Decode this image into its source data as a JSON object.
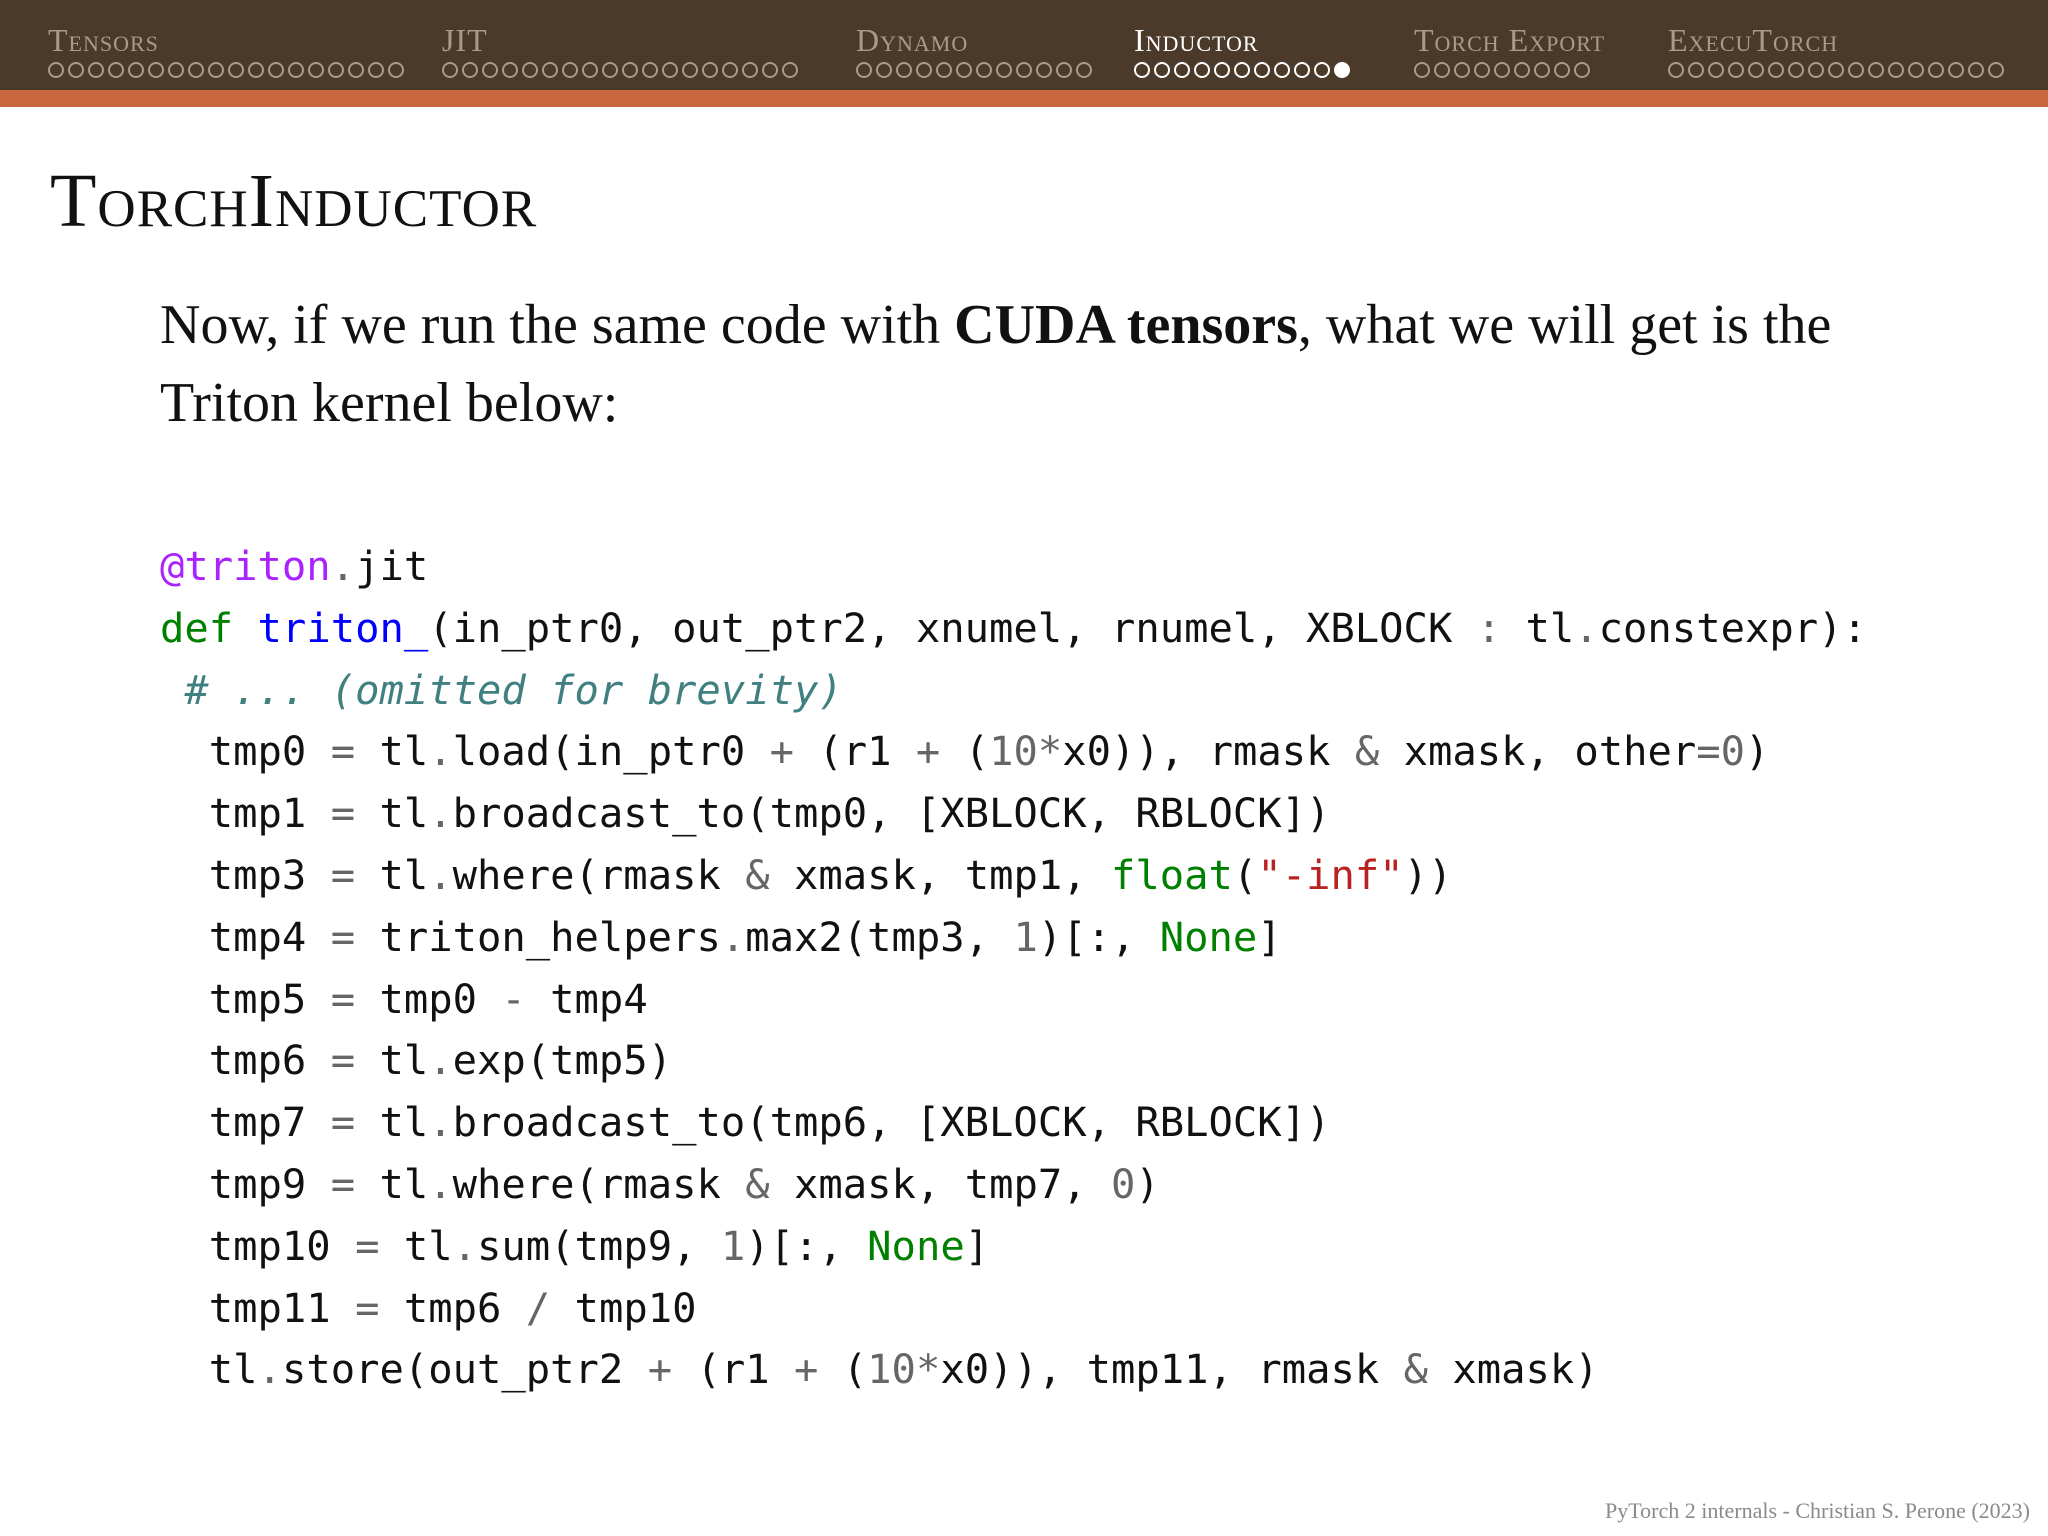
{
  "nav": {
    "sections": [
      {
        "label": "Tensors",
        "dots": 18,
        "current": false
      },
      {
        "label": "JIT",
        "dots": 18,
        "current": false
      },
      {
        "label": "Dynamo",
        "dots": 12,
        "current": false
      },
      {
        "label": "Inductor",
        "dots": 11,
        "current": true,
        "active_dot": 11
      },
      {
        "label": "Torch Export",
        "dots": 9,
        "current": false
      },
      {
        "label": "ExecuTorch",
        "dots": 17,
        "current": false
      }
    ]
  },
  "slide": {
    "title": "TorchInductor",
    "intro": {
      "before": "Now, if we run the same code with ",
      "bold": "CUDA tensors",
      "after": ", what we will get is the Triton kernel below:"
    },
    "code": [
      [
        [
          "nd",
          "@triton"
        ],
        [
          "op",
          "."
        ],
        [
          "",
          "jit"
        ]
      ],
      [
        [
          "kw",
          "def"
        ],
        [
          "",
          " "
        ],
        [
          "nf",
          "triton_"
        ],
        [
          "",
          "(in_ptr0, out_ptr2, xnumel, rnumel, XBLOCK "
        ],
        [
          "op",
          ":"
        ],
        [
          "",
          " tl"
        ],
        [
          "op",
          "."
        ],
        [
          "",
          "constexpr):"
        ]
      ],
      [
        [
          "",
          " "
        ],
        [
          "c1",
          "# ... (omitted for brevity)"
        ]
      ],
      [
        [
          "",
          "  tmp0 "
        ],
        [
          "op",
          "="
        ],
        [
          "",
          " tl"
        ],
        [
          "op",
          "."
        ],
        [
          "",
          "load(in_ptr0 "
        ],
        [
          "op",
          "+"
        ],
        [
          "",
          " (r1 "
        ],
        [
          "op",
          "+"
        ],
        [
          "",
          " ("
        ],
        [
          "mi",
          "10"
        ],
        [
          "op",
          "*"
        ],
        [
          "",
          "x0)), rmask "
        ],
        [
          "op",
          "&"
        ],
        [
          "",
          " xmask, other"
        ],
        [
          "op",
          "="
        ],
        [
          "mi",
          "0"
        ],
        [
          "",
          ")"
        ]
      ],
      [
        [
          "",
          "  tmp1 "
        ],
        [
          "op",
          "="
        ],
        [
          "",
          " tl"
        ],
        [
          "op",
          "."
        ],
        [
          "",
          "broadcast_to(tmp0, [XBLOCK, RBLOCK])"
        ]
      ],
      [
        [
          "",
          "  tmp3 "
        ],
        [
          "op",
          "="
        ],
        [
          "",
          " tl"
        ],
        [
          "op",
          "."
        ],
        [
          "",
          "where(rmask "
        ],
        [
          "op",
          "&"
        ],
        [
          "",
          " xmask, tmp1, "
        ],
        [
          "bi",
          "float"
        ],
        [
          "",
          "("
        ],
        [
          "st",
          "\"-inf\""
        ],
        [
          "",
          "))"
        ]
      ],
      [
        [
          "",
          "  tmp4 "
        ],
        [
          "op",
          "="
        ],
        [
          "",
          " triton_helpers"
        ],
        [
          "op",
          "."
        ],
        [
          "",
          "max2(tmp3, "
        ],
        [
          "mi",
          "1"
        ],
        [
          "",
          ")[:, "
        ],
        [
          "bi",
          "None"
        ],
        [
          "",
          "]"
        ]
      ],
      [
        [
          "",
          "  tmp5 "
        ],
        [
          "op",
          "="
        ],
        [
          "",
          " tmp0 "
        ],
        [
          "op",
          "-"
        ],
        [
          "",
          " tmp4"
        ]
      ],
      [
        [
          "",
          "  tmp6 "
        ],
        [
          "op",
          "="
        ],
        [
          "",
          " tl"
        ],
        [
          "op",
          "."
        ],
        [
          "",
          "exp(tmp5)"
        ]
      ],
      [
        [
          "",
          "  tmp7 "
        ],
        [
          "op",
          "="
        ],
        [
          "",
          " tl"
        ],
        [
          "op",
          "."
        ],
        [
          "",
          "broadcast_to(tmp6, [XBLOCK, RBLOCK])"
        ]
      ],
      [
        [
          "",
          "  tmp9 "
        ],
        [
          "op",
          "="
        ],
        [
          "",
          " tl"
        ],
        [
          "op",
          "."
        ],
        [
          "",
          "where(rmask "
        ],
        [
          "op",
          "&"
        ],
        [
          "",
          " xmask, tmp7, "
        ],
        [
          "mi",
          "0"
        ],
        [
          "",
          ")"
        ]
      ],
      [
        [
          "",
          "  tmp10 "
        ],
        [
          "op",
          "="
        ],
        [
          "",
          " tl"
        ],
        [
          "op",
          "."
        ],
        [
          "",
          "sum(tmp9, "
        ],
        [
          "mi",
          "1"
        ],
        [
          "",
          ")[:, "
        ],
        [
          "bi",
          "None"
        ],
        [
          "",
          "]"
        ]
      ],
      [
        [
          "",
          "  tmp11 "
        ],
        [
          "op",
          "="
        ],
        [
          "",
          " tmp6 "
        ],
        [
          "op",
          "/"
        ],
        [
          "",
          " tmp10"
        ]
      ],
      [
        [
          "",
          "  tl"
        ],
        [
          "op",
          "."
        ],
        [
          "",
          "store(out_ptr2 "
        ],
        [
          "op",
          "+"
        ],
        [
          "",
          " (r1 "
        ],
        [
          "op",
          "+"
        ],
        [
          "",
          " ("
        ],
        [
          "mi",
          "10"
        ],
        [
          "op",
          "*"
        ],
        [
          "",
          "x0)), tmp11, rmask "
        ],
        [
          "op",
          "&"
        ],
        [
          "",
          " xmask)"
        ]
      ]
    ]
  },
  "footer": "PyTorch 2 internals - Christian S. Perone (2023)",
  "colors": {
    "navbar": "#4b3a2a",
    "navbar_accent": "#c9683e",
    "nav_inactive": "#a89a8c",
    "nav_active": "#ffffff",
    "code_keyword": "#008000",
    "code_function": "#0000ff",
    "code_decorator": "#aa22ff",
    "code_operator": "#666666",
    "code_string": "#ba2121",
    "code_comment": "#408080"
  }
}
